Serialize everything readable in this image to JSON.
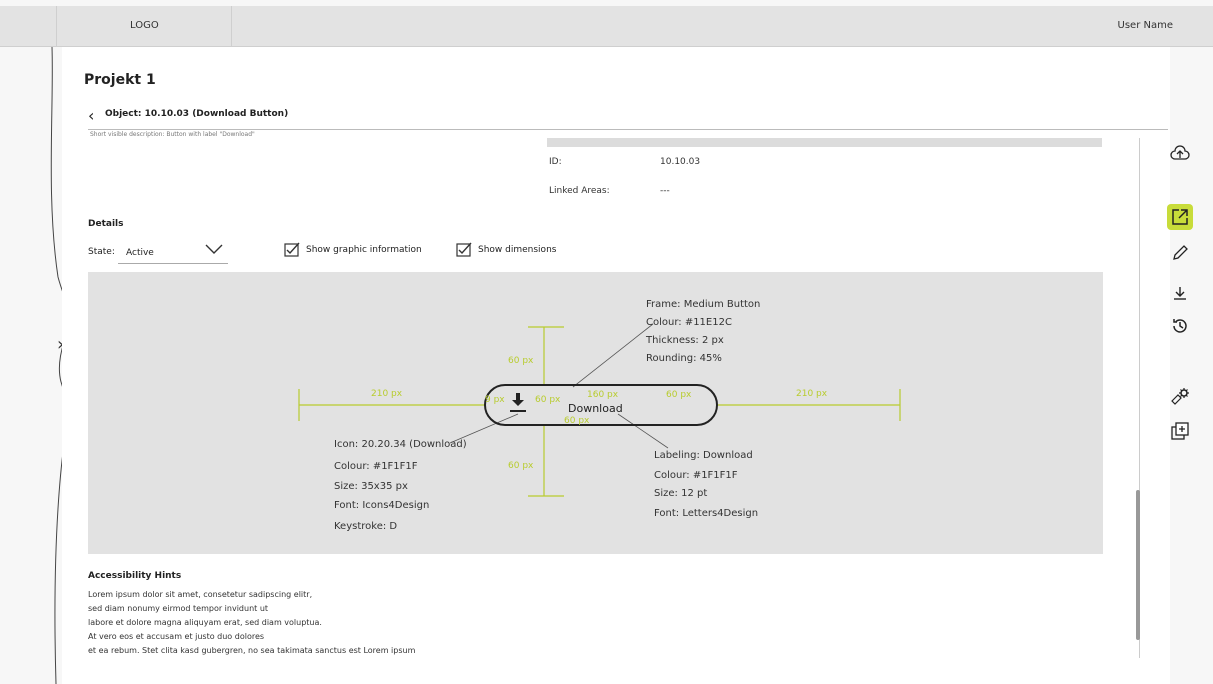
{
  "header": {
    "logo": "LOGO",
    "user_name": "User Name"
  },
  "project": {
    "title": "Projekt 1",
    "object_title": "Object: 10.10.03 (Download Button)"
  },
  "partial_text": "Short visible description: Button with label \"Download\"",
  "info": {
    "id_label": "ID:",
    "id_value": "10.10.03",
    "linked_label": "Linked Areas:",
    "linked_value": "---"
  },
  "details": {
    "title": "Details",
    "state_label": "State:",
    "state_value": "Active",
    "show_graphic_label": "Show graphic information",
    "show_dimensions_label": "Show dimensions"
  },
  "graphic": {
    "button_label": "Download",
    "dims": {
      "top": "60 px",
      "bottom": "60 px",
      "left": "210 px",
      "right": "210 px",
      "inner_left": "60 px",
      "inner_right": "60 px",
      "icon": "9 px",
      "width": "160 px",
      "padding": "60 px"
    },
    "frame": [
      "Frame: Medium Button",
      "Colour: #11E12C",
      "Thickness: 2 px",
      "Rounding: 45%"
    ],
    "icon": [
      "Icon: 20.20.34 (Download)",
      "Colour: #1F1F1F",
      "Size: 35x35 px",
      "Font: Icons4Design",
      "Keystroke: D"
    ],
    "labeling": [
      "Labeling: Download",
      "Colour: #1F1F1F",
      "Size: 12 pt",
      "Font: Letters4Design"
    ]
  },
  "accessibility": {
    "title": "Accessibility Hints",
    "lines": [
      "Lorem ipsum dolor sit amet, consetetur sadipscing elitr,",
      "sed diam nonumy eirmod tempor invidunt ut",
      "labore et dolore magna aliquyam erat, sed diam voluptua.",
      "At vero eos et accusam et justo duo dolores",
      "et ea rebum. Stet clita kasd gubergren, no sea takimata sanctus est Lorem ipsum"
    ]
  },
  "colors": {
    "accent": "#C8DC3A",
    "dimension": "#B8CC2E"
  },
  "toolbar_icons": [
    "cloud-upload-icon",
    "external-link-icon",
    "pencil-icon",
    "download-icon",
    "history-icon",
    "settings-icon",
    "add-layer-icon"
  ]
}
